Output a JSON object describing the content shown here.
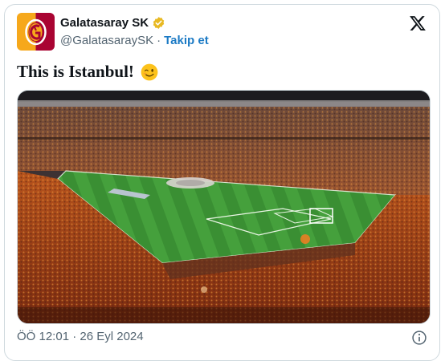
{
  "account": {
    "name": "Galatasaray SK",
    "handle": "@GalatasaraySK",
    "separator": "·",
    "follow_label": "Takip et",
    "verified_color": "#e8b923"
  },
  "tweet": {
    "text": "This is Istanbul!",
    "emoji_icon": "winking-face-emoji"
  },
  "meta": {
    "time": "ÖÖ 12:01",
    "separator": "·",
    "date": "26 Eyl 2024"
  },
  "colors": {
    "follow": "#1d7bc5",
    "text_secondary": "#536471",
    "brand_yellow": "#f6a81b",
    "brand_red": "#a90432",
    "pitch_green": "#3f9a3a"
  }
}
